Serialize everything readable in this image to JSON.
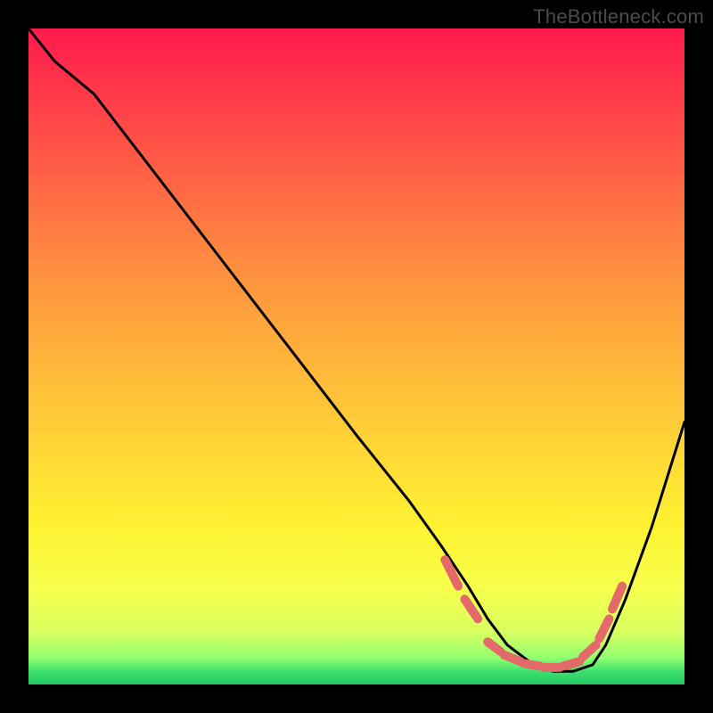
{
  "watermark": "TheBottleneck.com",
  "chart_data": {
    "type": "line",
    "title": "",
    "xlabel": "",
    "ylabel": "",
    "xlim": [
      0,
      100
    ],
    "ylim": [
      0,
      100
    ],
    "series": [
      {
        "name": "curve",
        "color": "#000000",
        "x": [
          0,
          4,
          10,
          20,
          30,
          40,
          50,
          58,
          63,
          67,
          70,
          73,
          77,
          80,
          83,
          86,
          88,
          91,
          95,
          100
        ],
        "y": [
          100,
          95,
          90,
          77,
          64,
          51,
          38,
          28,
          21,
          15,
          10,
          6,
          3,
          2,
          2,
          3,
          6,
          13,
          24,
          40
        ]
      },
      {
        "name": "bottom-dashes",
        "color": "#e46a6a",
        "segments": [
          {
            "x1": 63.5,
            "y1": 19,
            "x2": 65.5,
            "y2": 15
          },
          {
            "x1": 66.5,
            "y1": 13,
            "x2": 68.5,
            "y2": 10
          },
          {
            "x1": 70.0,
            "y1": 6.5,
            "x2": 72.0,
            "y2": 5.0
          },
          {
            "x1": 72.5,
            "y1": 4.5,
            "x2": 75.0,
            "y2": 3.5
          },
          {
            "x1": 75.5,
            "y1": 3.2,
            "x2": 78.0,
            "y2": 2.8
          },
          {
            "x1": 78.5,
            "y1": 2.6,
            "x2": 81.0,
            "y2": 2.6
          },
          {
            "x1": 81.5,
            "y1": 2.8,
            "x2": 84.0,
            "y2": 3.5
          },
          {
            "x1": 84.5,
            "y1": 4.2,
            "x2": 86.5,
            "y2": 6.0
          },
          {
            "x1": 87.0,
            "y1": 7.0,
            "x2": 88.5,
            "y2": 10.0
          },
          {
            "x1": 89.0,
            "y1": 11.5,
            "x2": 90.5,
            "y2": 15.0
          }
        ]
      }
    ]
  }
}
